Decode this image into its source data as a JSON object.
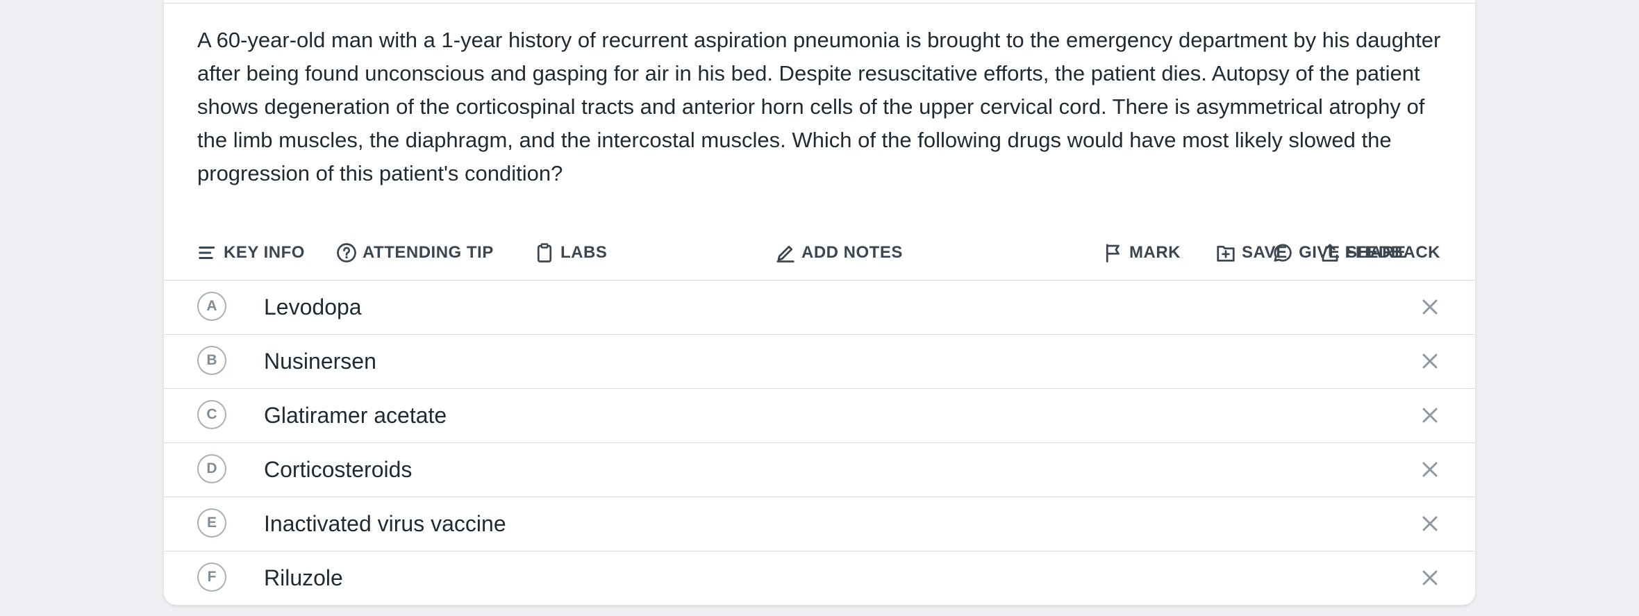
{
  "question": {
    "text": "A 60-year-old man with a 1-year history of recurrent aspiration pneumonia is brought to the emergency department by his daughter after being found unconscious and gasping for air in his bed. Despite resuscitative efforts, the patient dies. Autopsy of the patient shows degeneration of the corticospinal tracts and anterior horn cells of the upper cervical cord. There is asymmetrical atrophy of the limb muscles, the diaphragm, and the intercostal muscles. Which of the following drugs would have most likely slowed the progression of this patient's condition?"
  },
  "toolbar": {
    "key_info": "KEY INFO",
    "attending_tip": "ATTENDING TIP",
    "labs": "LABS",
    "add_notes": "ADD NOTES",
    "mark": "MARK",
    "save": "SAVE",
    "share": "SHARE",
    "give_feedback": "GIVE FEEDBACK"
  },
  "options": [
    {
      "letter": "A",
      "text": "Levodopa"
    },
    {
      "letter": "B",
      "text": "Nusinersen"
    },
    {
      "letter": "C",
      "text": "Glatiramer acetate"
    },
    {
      "letter": "D",
      "text": "Corticosteroids"
    },
    {
      "letter": "E",
      "text": "Inactivated virus vaccine"
    },
    {
      "letter": "F",
      "text": "Riluzole"
    }
  ],
  "colors": {
    "background": "#eef0f3",
    "card": "#ffffff",
    "text": "#1f2a33",
    "toolbar_text": "#3b4650",
    "muted": "#8d98a2"
  }
}
